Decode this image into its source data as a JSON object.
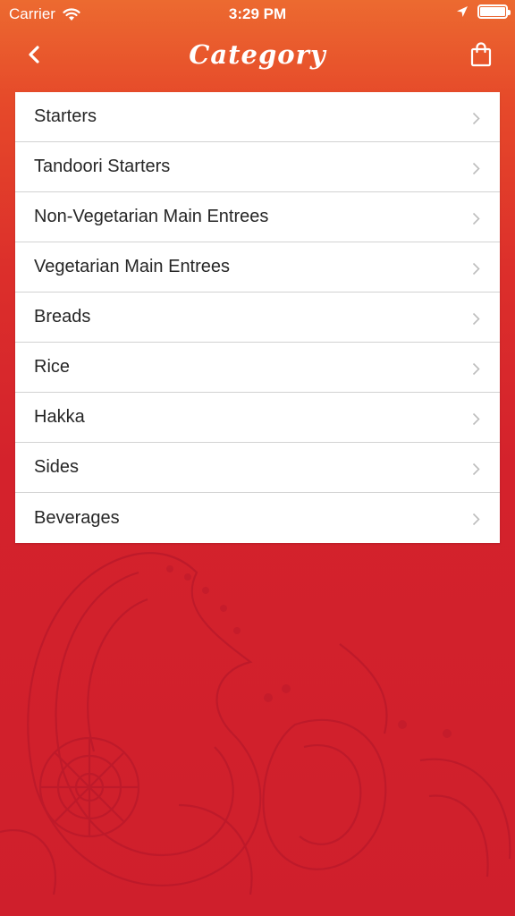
{
  "status_bar": {
    "carrier": "Carrier",
    "time": "3:29 PM"
  },
  "nav": {
    "title": "Category",
    "back_icon": "chevron-left-icon",
    "cart_icon": "shopping-bag-icon"
  },
  "categories": [
    {
      "label": "Starters"
    },
    {
      "label": "Tandoori Starters"
    },
    {
      "label": "Non-Vegetarian Main Entrees"
    },
    {
      "label": "Vegetarian Main Entrees"
    },
    {
      "label": "Breads"
    },
    {
      "label": "Rice"
    },
    {
      "label": "Hakka"
    },
    {
      "label": "Sides"
    },
    {
      "label": "Beverages"
    }
  ],
  "colors": {
    "header_orange": "#ec6a30",
    "background_red": "#cf1f2c",
    "list_bg": "#ffffff",
    "text": "#262626"
  }
}
